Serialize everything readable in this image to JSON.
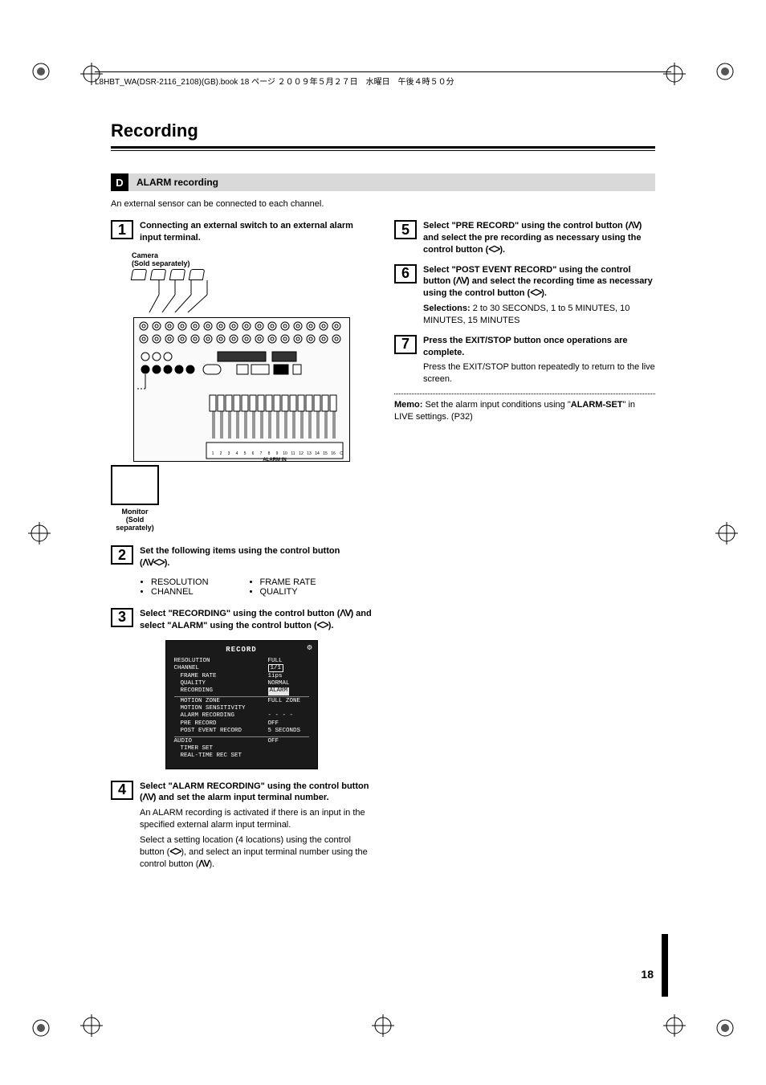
{
  "header": {
    "book_line": "L8HBT_WA(DSR-2116_2108)(GB).book  18 ページ  ２００９年５月２７日　水曜日　午後４時５０分"
  },
  "page": {
    "title": "Recording",
    "number": "18"
  },
  "section": {
    "letter": "D",
    "title": "ALARM recording",
    "intro": "An external sensor can be connected to each channel."
  },
  "diagram": {
    "camera_caption": "Camera\n(Sold separately)",
    "monitor_caption": "Monitor\n(Sold\nseparately)",
    "alarm_label": "ALARM IN"
  },
  "steps": {
    "s1": {
      "num": "1",
      "lead": "Connecting an external switch to an external alarm input terminal."
    },
    "s2": {
      "num": "2",
      "lead_a": "Set the following items using the control button (",
      "lead_b": ").",
      "bullets_left": [
        "RESOLUTION",
        "CHANNEL"
      ],
      "bullets_right": [
        "FRAME RATE",
        "QUALITY"
      ]
    },
    "s3": {
      "num": "3",
      "lead_a": "Select \"RECORDING\" using the control button (",
      "lead_b": ") and select \"ALARM\" using the control button (",
      "lead_c": ")."
    },
    "s4": {
      "num": "4",
      "lead_a": "Select \"ALARM RECORDING\" using the control button (",
      "lead_b": ") and set the alarm input terminal number.",
      "body1": "An ALARM recording is activated if there is an input in the specified external alarm input terminal.",
      "body2a": "Select a setting location (4 locations) using the control button (",
      "body2b": "), and select an input terminal number using the control button (",
      "body2c": ")."
    },
    "s5": {
      "num": "5",
      "lead_a": "Select \"PRE RECORD\" using the control button (",
      "lead_b": ") and select the pre recording as necessary using the control button (",
      "lead_c": ")."
    },
    "s6": {
      "num": "6",
      "lead_a": "Select \"POST EVENT RECORD\" using the control button (",
      "lead_b": ") and select the recording time as necessary using the control button (",
      "lead_c": ").",
      "sel_label": "Selections:",
      "sel_body": " 2 to 30 SECONDS, 1 to 5 MINUTES, 10 MINUTES, 15 MINUTES"
    },
    "s7": {
      "num": "7",
      "lead": "Press the EXIT/STOP button once operations are complete.",
      "body": "Press the EXIT/STOP button repeatedly to return to the live screen."
    }
  },
  "record_panel": {
    "title": "RECORD",
    "rows": [
      {
        "k": "RESOLUTION",
        "v": "FULL",
        "indent": false
      },
      {
        "k": "CHANNEL",
        "v": "1/1",
        "indent": false,
        "boxed": true
      },
      {
        "k": "FRAME RATE",
        "v": "1ips",
        "indent": true
      },
      {
        "k": "QUALITY",
        "v": "NORMAL",
        "indent": true
      },
      {
        "k": "RECORDING",
        "v": "ALARM",
        "indent": true,
        "hl": true
      },
      {
        "k": "MOTION ZONE",
        "v": "FULL ZONE",
        "indent": true
      },
      {
        "k": "MOTION SENSITIVITY",
        "v": "",
        "indent": true
      },
      {
        "k": "ALARM RECORDING",
        "v": "- - - -",
        "indent": true
      },
      {
        "k": "PRE RECORD",
        "v": "OFF",
        "indent": true
      },
      {
        "k": "POST EVENT RECORD",
        "v": "5 SECONDS",
        "indent": true
      },
      {
        "k": "AUDIO",
        "v": "OFF",
        "indent": false
      },
      {
        "k": "TIMER SET",
        "v": "",
        "indent": true
      },
      {
        "k": "REAL-TIME REC SET",
        "v": "",
        "indent": true
      }
    ]
  },
  "memo": {
    "label": "Memo:",
    "text_a": " Set the alarm input conditions using \"",
    "bold": "ALARM-SET",
    "text_b": "\" in LIVE settings. (P32)"
  },
  "glyphs": {
    "udlr": "ᐱᐯᐸᐳ",
    "ud": "ᐱᐯ",
    "lr": "ᐸᐳ"
  }
}
